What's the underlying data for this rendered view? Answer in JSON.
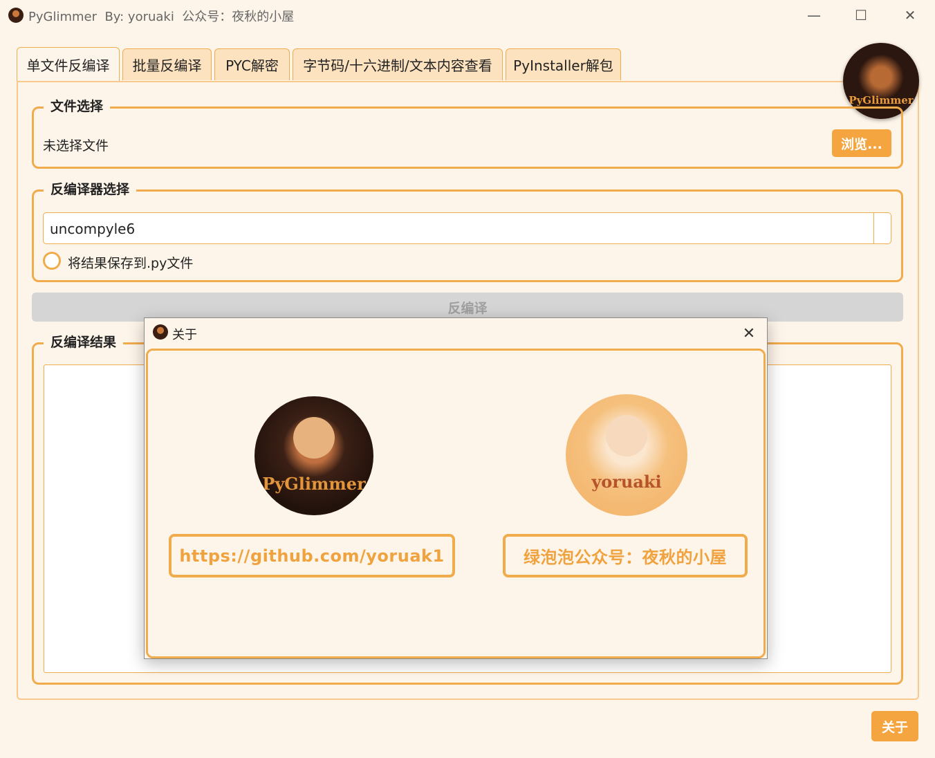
{
  "window": {
    "title": "PyGlimmer  By: yoruaki  公众号：夜秋的小屋",
    "controls": {
      "minimize": "—",
      "maximize": "☐",
      "close": "✕"
    }
  },
  "tabs": [
    {
      "label": "单文件反编译",
      "active": true
    },
    {
      "label": "批量反编译",
      "active": false
    },
    {
      "label": "PYC解密",
      "active": false
    },
    {
      "label": "字节码/十六进制/文本内容查看",
      "active": false
    },
    {
      "label": "PyInstaller解包",
      "active": false
    }
  ],
  "file_select": {
    "group_title": "文件选择",
    "status": "未选择文件",
    "browse_label": "浏览..."
  },
  "decompiler_select": {
    "group_title": "反编译器选择",
    "selected": "uncompyle6",
    "save_checkbox_label": "将结果保存到.py文件",
    "save_checked": false
  },
  "decompile_button": "反编译",
  "result": {
    "group_title": "反编译结果",
    "content": ""
  },
  "about_button": "关于",
  "about_dialog": {
    "title": "关于",
    "close": "✕",
    "logo_text": "PyGlimmer",
    "author_logo_text": "yoruaki",
    "github_link": "https://github.com/yoruak1",
    "wechat_label": "绿泡泡公众号：夜秋的小屋"
  },
  "colors": {
    "accent": "#f0ab4c",
    "button": "#f5a53f",
    "background": "#fef5ea",
    "disabled": "#d5d5d5"
  },
  "icons": {
    "app": "pyglimmer-logo-icon",
    "close": "close-icon"
  }
}
